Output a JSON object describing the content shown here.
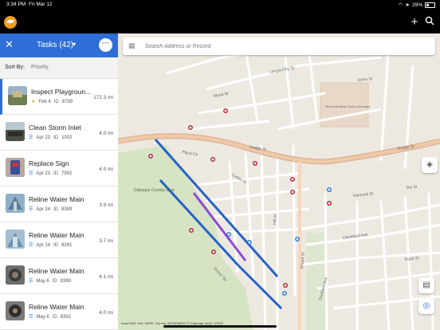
{
  "status": {
    "time": "3:34 PM",
    "date": "Fri Mar 12",
    "battery": "29%"
  },
  "header": {
    "add_icon": "plus-icon",
    "search_icon": "search-icon"
  },
  "panel": {
    "title": "Tasks (42)",
    "sort_label": "Sort By:",
    "sort_value": "Priority",
    "tasks": [
      {
        "title": "Inspect Playgroun...",
        "date": "Feb 4",
        "id_label": "ID",
        "id": "8799",
        "distance": "172.3 mi",
        "icon": "star-icon",
        "thumb": "#7a8a6a"
      },
      {
        "title": "Clean Storm Inlet",
        "date": "Apr 23",
        "id_label": "ID",
        "id": "1002",
        "distance": "4.0 mi",
        "icon": "list-icon",
        "thumb": "#4d5a4a"
      },
      {
        "title": "Replace Sign",
        "date": "Apr 23",
        "id_label": "ID",
        "id": "7992",
        "distance": "4.0 mi",
        "icon": "list-icon",
        "thumb": "#8a4a5a"
      },
      {
        "title": "Reline Water Main",
        "date": "Apr 24",
        "id_label": "ID",
        "id": "8389",
        "distance": "3.9 mi",
        "icon": "list-icon",
        "thumb": "#6b93b0"
      },
      {
        "title": "Reline Water Main",
        "date": "Apr 24",
        "id_label": "ID",
        "id": "8391",
        "distance": "3.7 mi",
        "icon": "list-icon",
        "thumb": "#7ea3bd"
      },
      {
        "title": "Reline Water Main",
        "date": "May 6",
        "id_label": "ID",
        "id": "8390",
        "distance": "4.1 mi",
        "icon": "list-icon",
        "thumb": "#5a5a5a"
      },
      {
        "title": "Reline Water Main",
        "date": "May 6",
        "id_label": "ID",
        "id": "8392",
        "distance": "4.0 mi",
        "icon": "list-icon",
        "thumb": "#6a6a6a"
      }
    ]
  },
  "map": {
    "search_placeholder": "Search Address or Record",
    "attribution": "Iowa DNR, Esri, HERE, Garmin, INCREMENT P, Intermap, NGA, USGS",
    "labels": {
      "dodge1": "Dodge St",
      "dodge2": "Dodge St",
      "bryant": "Bryant St",
      "hill": "Hill St",
      "cleveland": "Cleveland Ave",
      "rush": "Rush St",
      "hancock": "Hancock St",
      "dixon": "Dix St",
      "plaza": "Plaza Ctr",
      "corbin": "Corbin St",
      "club": "Dubuque Country Club",
      "mercy": "Mercy Medical Center-Dubuque",
      "wood": "Wood St",
      "grove": "Grove Ter",
      "langworthy": "Langworthy St",
      "jones": "Jones St",
      "southern": "Southern Ave"
    },
    "colors": {
      "route_blue": "#2563c9",
      "route_purple": "#8e4ad6",
      "road_major": "#e4a98a",
      "marker_red": "#b5263a",
      "marker_blue": "#2f7bd9"
    }
  }
}
